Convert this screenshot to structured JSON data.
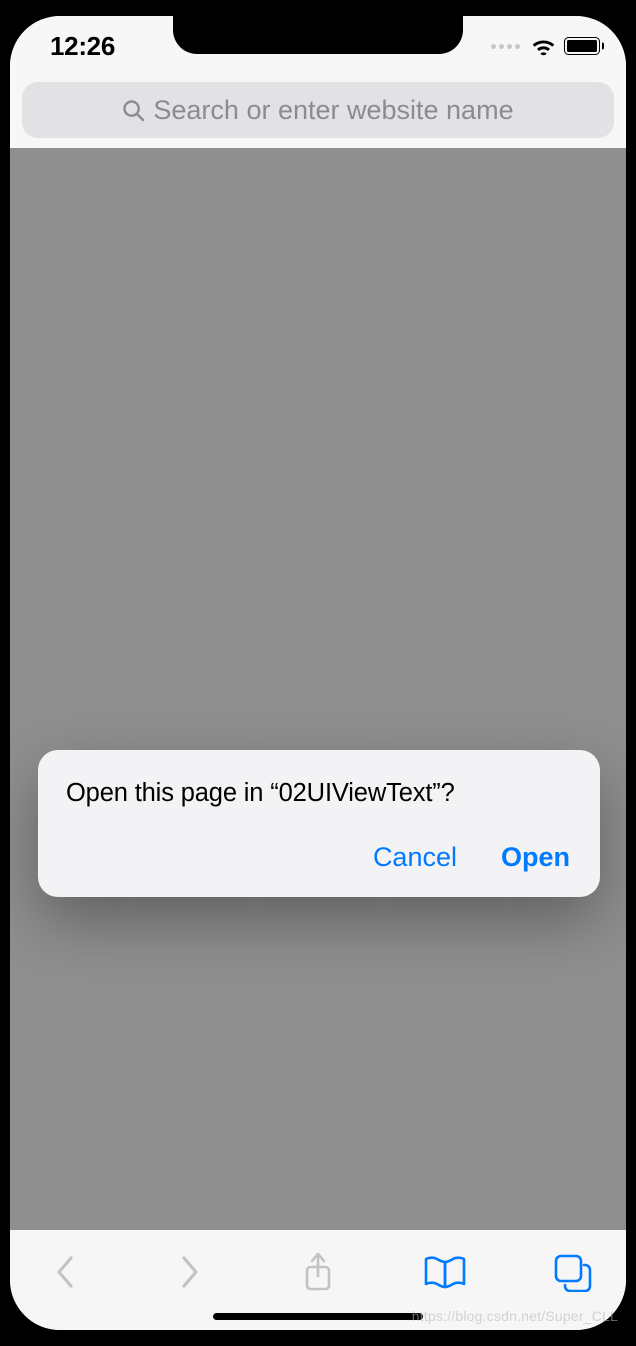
{
  "status": {
    "time": "12:26"
  },
  "search": {
    "placeholder": "Search or enter website name"
  },
  "alert": {
    "message": "Open this page in “02UIViewText”?",
    "cancel_label": "Cancel",
    "open_label": "Open"
  },
  "watermark": "https://blog.csdn.net/Super_CLL",
  "colors": {
    "accent": "#007aff",
    "disabled": "#c3c3c5"
  }
}
